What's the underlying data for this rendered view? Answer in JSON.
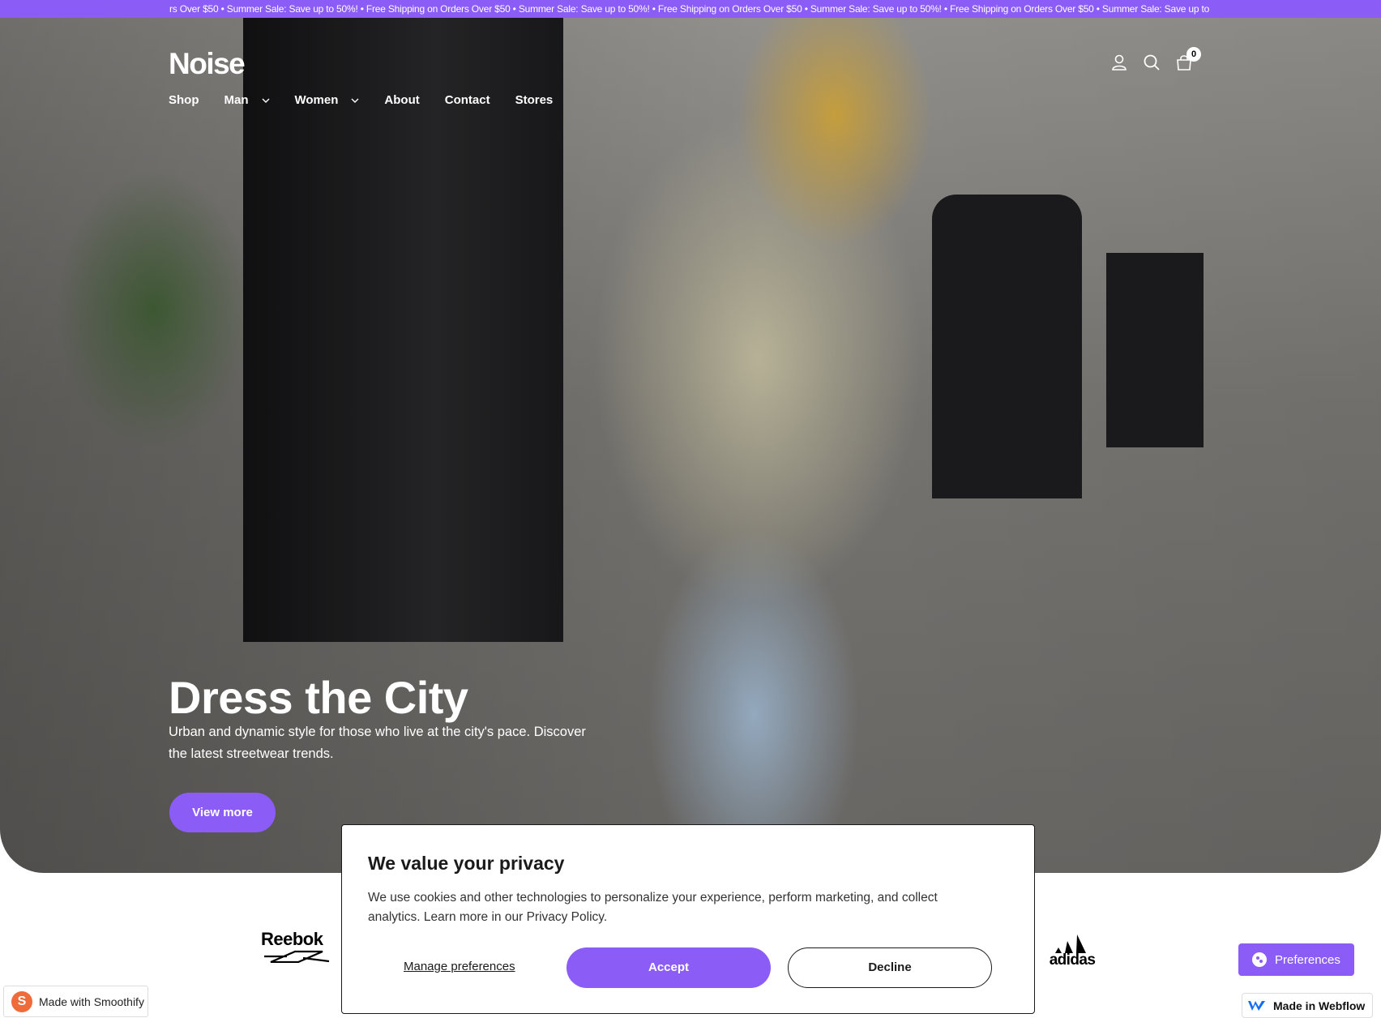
{
  "announcement": {
    "text": "rs Over $50 • Summer Sale: Save up to 50%! • Free Shipping on Orders Over $50 • Summer Sale: Save up to 50%! • Free Shipping on Orders Over $50 • Summer Sale: Save up to 50%! • Free Shipping on Orders Over $50 • Summer Sale: Save up to"
  },
  "header": {
    "logo": "Noise",
    "nav": [
      {
        "label": "Shop"
      },
      {
        "label": "Man"
      },
      {
        "label": "Women"
      },
      {
        "label": "About"
      },
      {
        "label": "Contact"
      },
      {
        "label": "Stores"
      }
    ],
    "cart_count": "0"
  },
  "hero": {
    "title": "Dress the City",
    "text": "Urban and dynamic style for those who live at the city's pace. Discover the latest streetwear trends.",
    "button": "View more"
  },
  "brands": {
    "reebok": "Reebok",
    "adidas": "adidas"
  },
  "cookie": {
    "title": "We value your privacy",
    "text": "We use cookies and other technologies to personalize your experience, perform marketing, and collect analytics. Learn more in our Privacy Policy.",
    "manage": "Manage preferences",
    "accept": "Accept",
    "decline": "Decline"
  },
  "preferences": {
    "label": "Preferences"
  },
  "smoothify": {
    "label": "Made with Smoothify",
    "logo": "S"
  },
  "webflow": {
    "label": "Made in Webflow"
  },
  "colors": {
    "accent": "#8b5cf6"
  }
}
